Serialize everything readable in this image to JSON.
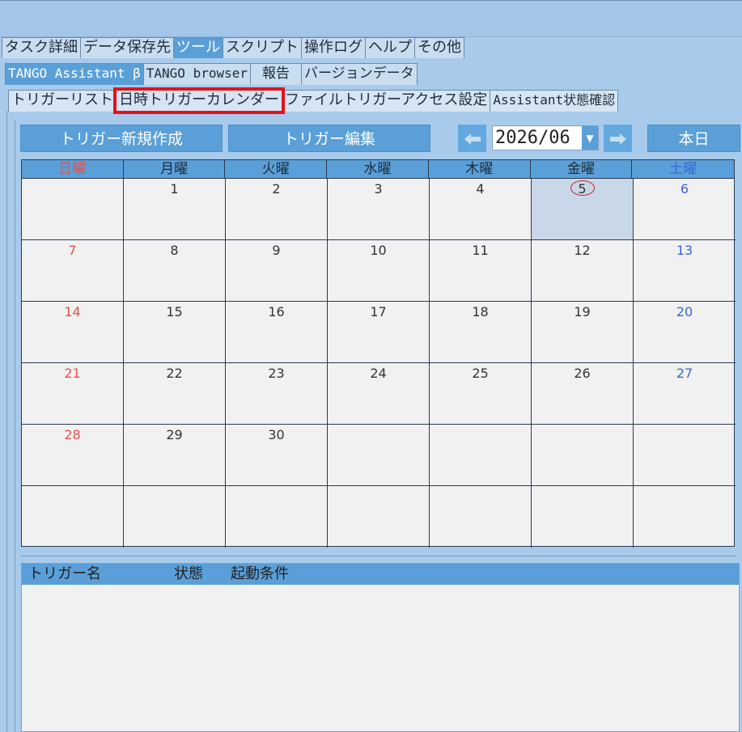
{
  "main_tabs": [
    "タスク詳細",
    "データ保存先",
    "ツール",
    "スクリプト",
    "操作ログ",
    "ヘルプ",
    "その他"
  ],
  "main_tab_active": "ツール",
  "tool_tabs": [
    "TANGO Assistant β",
    "TANGO browser",
    "報告",
    "バージョンデータ"
  ],
  "assistant_tabs": [
    "トリガーリスト",
    "日時トリガーカレンダー",
    "ファイルトリガーアクセス設定",
    "Assistant状態確認"
  ],
  "toolbar": {
    "new_trigger": "トリガー新規作成",
    "edit_trigger": "トリガー編集",
    "month": "2026/06",
    "today": "本日",
    "prev_icon": "arrow-left-icon",
    "next_icon": "arrow-right-icon"
  },
  "calendar": {
    "weekdays": [
      "日曜",
      "月曜",
      "火曜",
      "水曜",
      "木曜",
      "金曜",
      "土曜"
    ],
    "weeks": [
      [
        "",
        "1",
        "2",
        "3",
        "4",
        "5",
        "6"
      ],
      [
        "7",
        "8",
        "9",
        "10",
        "11",
        "12",
        "13"
      ],
      [
        "14",
        "15",
        "16",
        "17",
        "18",
        "19",
        "20"
      ],
      [
        "21",
        "22",
        "23",
        "24",
        "25",
        "26",
        "27"
      ],
      [
        "28",
        "29",
        "30",
        "",
        "",
        "",
        ""
      ],
      [
        "",
        "",
        "",
        "",
        "",
        "",
        ""
      ]
    ],
    "today": "5"
  },
  "trigger_list": {
    "columns": [
      "トリガー名",
      "状態",
      "起動条件"
    ]
  },
  "colors": {
    "accent": "#5a9fd8",
    "background": "#a8cbec",
    "sunday": "#e8504a",
    "saturday": "#3a66d6",
    "highlight_border": "#e3121b"
  }
}
